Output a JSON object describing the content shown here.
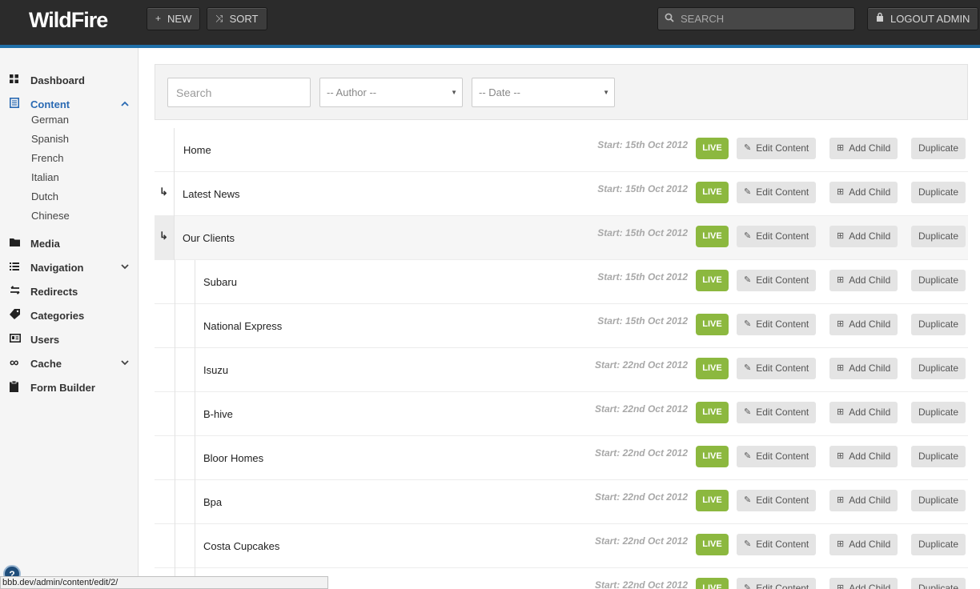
{
  "app": {
    "logo": "WildFire"
  },
  "toolbar": {
    "new_label": "NEW",
    "sort_label": "SORT",
    "search_placeholder": "SEARCH",
    "logout_label": "LOGOUT ADMIN"
  },
  "sidebar": {
    "items": [
      {
        "label": "Dashboard",
        "icon": "grid-icon"
      },
      {
        "label": "Content",
        "icon": "document-icon",
        "active": true
      },
      {
        "label": "Media",
        "icon": "folder-icon"
      },
      {
        "label": "Navigation",
        "icon": "list-icon"
      },
      {
        "label": "Redirects",
        "icon": "redirect-icon"
      },
      {
        "label": "Categories",
        "icon": "tag-icon"
      },
      {
        "label": "Users",
        "icon": "user-card-icon"
      },
      {
        "label": "Cache",
        "icon": "infinity-icon"
      },
      {
        "label": "Form Builder",
        "icon": "clipboard-icon"
      }
    ],
    "content_languages": [
      "German",
      "Spanish",
      "French",
      "Italian",
      "Dutch",
      "Chinese"
    ]
  },
  "filters": {
    "search_placeholder": "Search",
    "author_select": "-- Author --",
    "date_select": "-- Date --"
  },
  "row_labels": {
    "live": "LIVE",
    "edit": "Edit Content",
    "add_child": "Add Child",
    "duplicate": "Duplicate"
  },
  "rows": [
    {
      "title": "Home",
      "start": "Start: 15th Oct 2012"
    },
    {
      "title": "Latest News",
      "start": "Start: 15th Oct 2012"
    },
    {
      "title": "Our Clients",
      "start": "Start: 15th Oct 2012"
    },
    {
      "title": "Subaru",
      "start": "Start: 15th Oct 2012"
    },
    {
      "title": "National Express",
      "start": "Start: 15th Oct 2012"
    },
    {
      "title": "Isuzu",
      "start": "Start: 22nd Oct 2012"
    },
    {
      "title": "B-hive",
      "start": "Start: 22nd Oct 2012"
    },
    {
      "title": "Bloor Homes",
      "start": "Start: 22nd Oct 2012"
    },
    {
      "title": "Bpa",
      "start": "Start: 22nd Oct 2012"
    },
    {
      "title": "Costa Cupcakes",
      "start": "Start: 22nd Oct 2012"
    },
    {
      "title": "",
      "start": "Start: 22nd Oct 2012"
    }
  ],
  "statusbar": {
    "url": "bbb.dev/admin/content/edit/2/"
  },
  "colors": {
    "accent": "#1f6fa8",
    "live": "#8cb83f",
    "active_nav": "#2a6ab3"
  }
}
